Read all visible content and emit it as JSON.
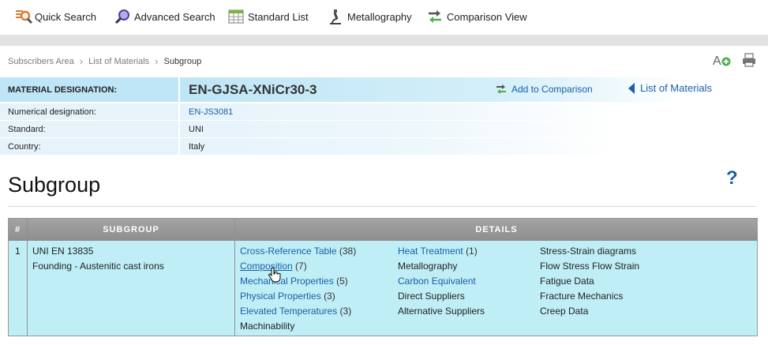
{
  "toolbar": {
    "items": [
      {
        "label": "Quick Search",
        "icon": "quick-search-icon"
      },
      {
        "label": "Advanced Search",
        "icon": "advanced-search-icon"
      },
      {
        "label": "Standard List",
        "icon": "table-icon"
      },
      {
        "label": "Metallography",
        "icon": "microscope-icon"
      },
      {
        "label": "Comparison View",
        "icon": "swap-arrows-icon"
      }
    ]
  },
  "breadcrumb": [
    "Subscribers Area",
    "List of Materials",
    "Subgroup"
  ],
  "material": {
    "designation_label": "MATERIAL DESIGNATION:",
    "designation": "EN-GJSA-XNiCr30-3",
    "numerical_label": "Numerical designation:",
    "numerical": "EN-JS3081",
    "standard_label": "Standard:",
    "standard": "UNI",
    "country_label": "Country:",
    "country": "Italy"
  },
  "actions": {
    "add_to_comparison": "Add to Comparison",
    "list_of_materials": "List of Materials"
  },
  "page_title": "Subgroup",
  "help_glyph": "?",
  "table": {
    "headers": [
      "#",
      "SUBGROUP",
      "DETAILS"
    ],
    "row": {
      "num": "1",
      "subgroup_line1": "UNI EN 13835",
      "subgroup_line2": "Founding - Austenitic cast irons",
      "col1": [
        {
          "label": "Cross-Reference Table",
          "count": "(38)"
        },
        {
          "label": "Composition",
          "count": "(7)"
        },
        {
          "label": "Mechanical Properties",
          "count": "(5)"
        },
        {
          "label": "Physical Properties",
          "count": "(3)"
        },
        {
          "label": "Elevated Temperatures",
          "count": "(3)"
        },
        {
          "label": "Machinability",
          "count": ""
        }
      ],
      "col2": [
        {
          "label": "Heat Treatment",
          "count": "(1)"
        },
        {
          "label": "Metallography",
          "count": ""
        },
        {
          "label": "Carbon Equivalent",
          "count": ""
        },
        {
          "label": "Direct Suppliers",
          "count": ""
        },
        {
          "label": "Alternative Suppliers",
          "count": ""
        }
      ],
      "col3": [
        {
          "label": "Stress-Strain diagrams"
        },
        {
          "label": "Flow Stress Flow Strain"
        },
        {
          "label": "Fatigue Data"
        },
        {
          "label": "Fracture Mechanics"
        },
        {
          "label": "Creep Data"
        }
      ]
    }
  },
  "colors": {
    "link": "#1a5fa8",
    "header_bg": "#bfe6f6",
    "row_bg": "#bfeef6",
    "table_head": "#9a9a9a"
  }
}
